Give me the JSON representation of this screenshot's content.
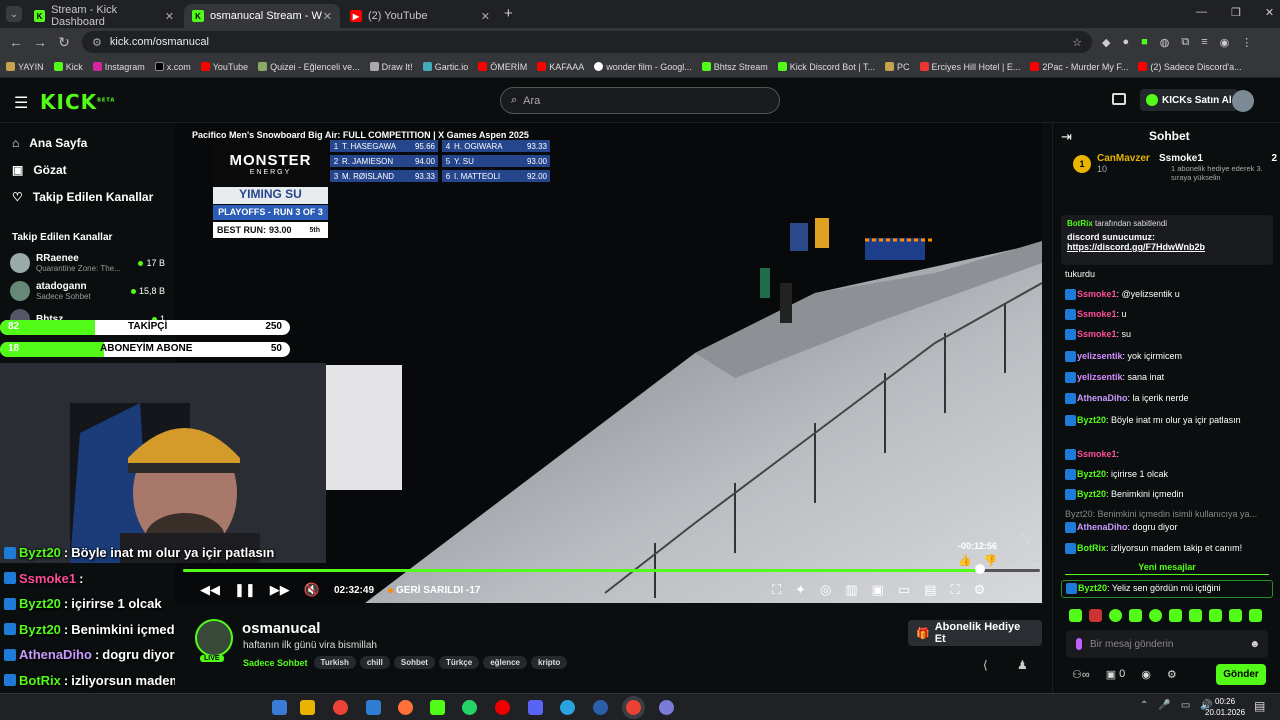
{
  "browser": {
    "tabs": [
      {
        "title": "Stream - Kick Dashboard",
        "active": false
      },
      {
        "title": "osmanucal Stream - Watch Live",
        "active": true
      },
      {
        "title": "(2) YouTube",
        "active": false
      }
    ],
    "new_tab": "+",
    "url": "kick.com/osmanucal",
    "bookmarks": [
      "YAYIN",
      "Kick",
      "Instagram",
      "x.com",
      "YouTube",
      "Quizei - Eğlenceli ve...",
      "Draw It!",
      "Gartic.io",
      "ÖMERİM",
      "KAFAAA",
      "wonder film - Googl...",
      "Bhtsz Stream",
      "Kick Discord Bot | T...",
      "PC",
      "Erciyes Hill Hotel | E...",
      "2Pac - Murder My F...",
      "(2) Sadece Discord'a..."
    ]
  },
  "header": {
    "logo": "KICK",
    "logo_sup": "BETA",
    "search_placeholder": "Ara",
    "kicks_button": "KICKs Satın Al"
  },
  "sidebar": {
    "nav": [
      {
        "label": "Ana Sayfa",
        "icon": "home-icon"
      },
      {
        "label": "Gözat",
        "icon": "browse-icon"
      },
      {
        "label": "Takip Edilen Kanallar",
        "icon": "heart-icon"
      }
    ],
    "section_title": "Takip Edilen Kanallar",
    "channels": [
      {
        "name": "RRaenee",
        "category": "Quarantine Zone: The...",
        "viewers": "17 B"
      },
      {
        "name": "atadogann",
        "category": "Sadece Sohbet",
        "viewers": "15,8 B"
      },
      {
        "name": "Bhtsz",
        "category": "",
        "viewers": "1"
      }
    ]
  },
  "video": {
    "title": "Pacifico Men's Snowboard Big Air: FULL COMPETITION | X Games Aspen 2025",
    "sponsor": "MONSTER",
    "sponsor_sub": "ENERGY",
    "rider": "YIMING SU",
    "round": "PLAYOFFS - RUN 3 OF 3",
    "best_run_label": "BEST RUN:",
    "best_run_value": "93.00",
    "best_run_rank": "5th",
    "scores": [
      {
        "rank": "1",
        "name": "T. HASEGAWA",
        "score": "95.66"
      },
      {
        "rank": "2",
        "name": "R. JAMIESON",
        "score": "94.00"
      },
      {
        "rank": "3",
        "name": "M. RØISLAND",
        "score": "93.33"
      },
      {
        "rank": "4",
        "name": "H. OGIWARA",
        "score": "93.33"
      },
      {
        "rank": "5",
        "name": "Y. SU",
        "score": "93.00"
      },
      {
        "rank": "6",
        "name": "I. MATTEOLI",
        "score": "92.00"
      }
    ],
    "hover_time": "-00:12:56",
    "elapsed": "02:32:49",
    "rewind_label": "GERİ SARILDI -17",
    "progress": 0.93
  },
  "overlay": {
    "follow_goal_label": "TAKİPÇİ",
    "follow_goal_current": "82",
    "follow_goal_target": "250",
    "sub_goal_label": "ABONEYİM ABONE",
    "sub_goal_current": "18",
    "sub_goal_target": "50",
    "chat_lines": [
      {
        "user": "Byzt20",
        "text": "Böyle inat mı olur ya içir patlasın",
        "color": "#53fc18"
      },
      {
        "user": "Ssmoke1",
        "text": "",
        "color": "#ff4d9a"
      },
      {
        "user": "Byzt20",
        "text": "içirirse 1 olcak",
        "color": "#53fc18"
      },
      {
        "user": "Byzt20",
        "text": "Benimkini içmedin",
        "color": "#53fc18"
      },
      {
        "user": "AthenaDiho",
        "text": "dogru diyor",
        "color": "#c89bff"
      },
      {
        "user": "BotRix",
        "text": "izliyorsun madem takip et canım!",
        "color": "#53fc18"
      },
      {
        "user": "Byzt20",
        "text": "Yeliz sen gördün mü içtiğini",
        "color": "#53fc18"
      }
    ]
  },
  "stream": {
    "channel": "osmanucal",
    "title": "haftanın ilk günü vira bismillah",
    "category": "Sadece Sohbet",
    "live_badge": "LIVE",
    "tags": [
      "Turkish",
      "chill",
      "Sohbet",
      "Türkçe",
      "eğlence",
      "kripto"
    ],
    "gift_button": "Abonelik Hediye Et"
  },
  "chat": {
    "title": "Sohbet",
    "top_gifters": [
      {
        "rank": "1",
        "name": "CanMavzer",
        "amount": "10"
      },
      {
        "name": "Ssmoke1",
        "amount": "2",
        "note": "1 abonelik hediye ederek 3. sıraya yükselin"
      }
    ],
    "pinned_by": "BotRix",
    "pinned_suffix": "tarafından sabitlendi",
    "pinned_title": "discord sunucumuz:",
    "pinned_link": "https://discord.gg/F7HdwWnb2b",
    "messages": [
      {
        "user": "",
        "text": "tukurdu",
        "color": "#fff"
      },
      {
        "user": "Ssmoke1",
        "text": "@yelizsentik u",
        "color": "#ff4d9a"
      },
      {
        "user": "Ssmoke1",
        "text": "u",
        "color": "#ff4d9a"
      },
      {
        "user": "Ssmoke1",
        "text": "su",
        "color": "#ff4d9a"
      },
      {
        "user": "yelizsentik",
        "text": "yok içirmicem",
        "color": "#d48cff"
      },
      {
        "user": "yelizsentik",
        "text": "sana inat",
        "color": "#d48cff"
      },
      {
        "user": "AthenaDiho",
        "text": "la içerik nerde",
        "color": "#c89bff"
      },
      {
        "user": "Byzt20",
        "text": "Böyle inat mı olur ya içir patlasın",
        "color": "#53fc18"
      },
      {
        "user": "Ssmoke1",
        "text": "",
        "color": "#ff4d9a"
      },
      {
        "user": "Byzt20",
        "text": "içirirse 1 olcak",
        "color": "#53fc18"
      },
      {
        "user": "Byzt20",
        "text": "Benimkini içmedin",
        "color": "#53fc18"
      },
      {
        "user": "",
        "text": "Byzt20: Benimkini içmedin isimli kullanıcıya ya...",
        "color": "#888"
      },
      {
        "user": "AthenaDiho",
        "text": "dogru diyor",
        "color": "#c89bff"
      },
      {
        "user": "BotRix",
        "text": "izliyorsun madem takip et canım!",
        "color": "#53fc18"
      }
    ],
    "new_messages": "Yeni mesajlar",
    "latest": {
      "user": "Byzt20",
      "text": "Yeliz sen gördün mü içtiğini",
      "color": "#53fc18"
    },
    "input_placeholder": "Bir mesaj gönderin",
    "points": "0",
    "send_button": "Gönder"
  },
  "taskbar": {
    "time": "00:26",
    "date": "20.01.2026"
  }
}
